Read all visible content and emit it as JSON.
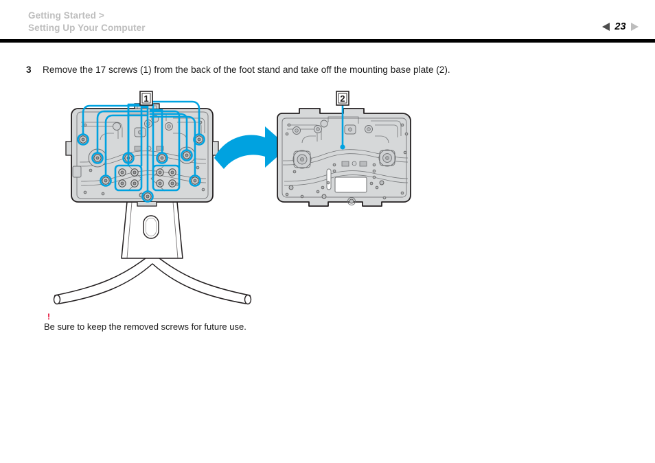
{
  "header": {
    "breadcrumb_line1": "Getting Started >",
    "breadcrumb_line2": "Setting Up Your Computer",
    "page_number": "23",
    "prev_icon": "triangle-left-icon",
    "next_icon": "triangle-right-icon",
    "breadcrumb_color": "#bdbdbd",
    "rule_color": "#000000"
  },
  "step": {
    "number": "3",
    "text": "Remove the 17 screws (1) from the back of the foot stand and take off the mounting base plate (2)."
  },
  "figure": {
    "callout_1": "1",
    "callout_2": "2",
    "accent_color": "#00a2e0",
    "plate_fill": "#d6d8d9",
    "outline_color": "#231f20",
    "arrow_icon": "curved-arrow-right-icon",
    "left_caption": "foot stand with 17 highlighted screws",
    "right_caption": "mounting base plate"
  },
  "note": {
    "icon": "exclamation-icon",
    "icon_color": "#e4002b",
    "text": "Be sure to keep the removed screws for future use."
  }
}
